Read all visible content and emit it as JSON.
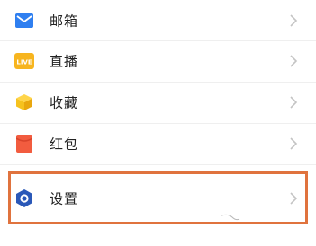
{
  "menu": {
    "items": [
      {
        "label": "邮箱",
        "icon": "mail-icon"
      },
      {
        "label": "直播",
        "icon": "live-icon",
        "badge": "LIVE"
      },
      {
        "label": "收藏",
        "icon": "favorites-box-icon"
      },
      {
        "label": "红包",
        "icon": "red-envelope-icon"
      },
      {
        "label": "设置",
        "icon": "settings-hexagon-icon"
      }
    ]
  },
  "colors": {
    "mail": "#2f7ff0",
    "live": "#f7b51f",
    "favorites": "#f6c21e",
    "red_envelope": "#f25c3f",
    "settings": "#2a58b8",
    "highlight": "#e0733e",
    "chevron": "#c4c4c4"
  }
}
